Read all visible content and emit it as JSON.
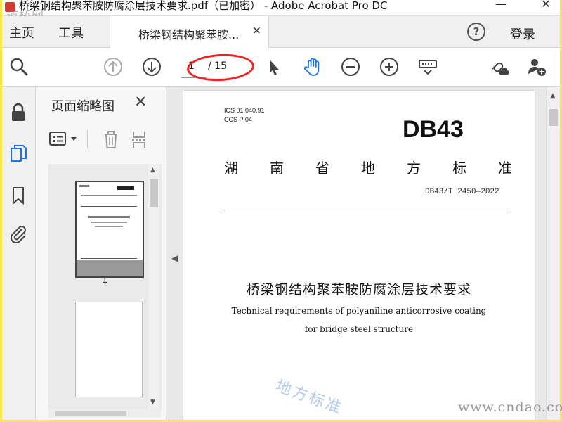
{
  "window": {
    "title": "桥梁钢结构聚苯胺防腐涂层技术要求.pdf（已加密） - Adobe Acrobat Pro DC",
    "minimize": "—",
    "close": "✕"
  },
  "watermark_top": "道桥网",
  "menubar": {
    "home": "主页",
    "tools": "工具",
    "tab_label": "桥梁钢结构聚苯胺...",
    "tab_close": "✕",
    "help": "?",
    "login": "登录"
  },
  "toolbar": {
    "page_current": "1",
    "page_total": "/ 15"
  },
  "thumbnails": {
    "title": "页面缩略图",
    "close": "✕",
    "page1_label": "1"
  },
  "document": {
    "ics": "ICS 01.040.91",
    "ccs": "CCS P 04",
    "db_mark": "DB43",
    "province_chars": [
      "湖",
      "南",
      "省",
      "地",
      "方",
      "标",
      "准"
    ],
    "standard_no": "DB43/T 2450—2022",
    "cn_title": "桥梁钢结构聚苯胺防腐涂层技术要求",
    "en_title_line1": "Technical requirements of polyaniline anticorrosive coating",
    "en_title_line2": "for bridge steel structure",
    "watermark": "地方标准"
  },
  "watermark_bottom": "www.cndao.com",
  "colors": {
    "border_yellow": "#f7e94a",
    "accent_blue": "#1a73e8",
    "annotation_red": "#e22222"
  }
}
